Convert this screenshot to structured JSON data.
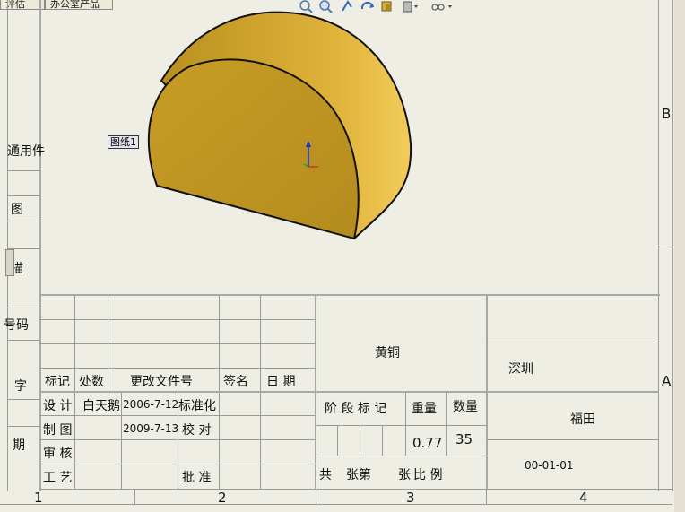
{
  "top_tabs": [
    "评估",
    "办公室产品"
  ],
  "sheet_label": "图纸1",
  "zones": {
    "right": [
      "B",
      "A"
    ],
    "bottom": [
      "1",
      "2",
      "3",
      "4"
    ]
  },
  "left_labels": [
    "通用件",
    "图",
    "描",
    "号码",
    "字",
    "期"
  ],
  "revision": {
    "headers": [
      "标记",
      "处数",
      "更改文件号",
      "签名",
      "日 期"
    ]
  },
  "approval": {
    "design_label": "设 计",
    "designer": "白天鹅",
    "design_date": "2006-7-12",
    "standardize_label": "标准化",
    "draw_label": "制 图",
    "draw_date": "2009-7-13",
    "check_label": "校 对",
    "review_label": "审 核",
    "process_label": "工 艺",
    "approve_label": "批 准"
  },
  "material": "黄铜",
  "company": "深圳",
  "part_name": "福田",
  "drawing_number": "00-01-01",
  "stage": {
    "stage_label": "阶 段 标 记",
    "weight_label": "重量",
    "qty_label": "数量",
    "weight": "0.77",
    "qty": "35",
    "total_sheets_label": "共",
    "sheet_label": "张第",
    "sheet_no_label": "张",
    "scale_label": "比 例"
  },
  "colors": {
    "part_face": "#c9a02a",
    "part_side": "#e0b53a",
    "axis": "#1a33cc"
  },
  "toolbar_icons": [
    "zoom-fit-icon",
    "zoom-area-icon",
    "pan-icon",
    "rotate-icon",
    "view-orientation-icon",
    "display-style-icon",
    "hide-show-icon"
  ]
}
